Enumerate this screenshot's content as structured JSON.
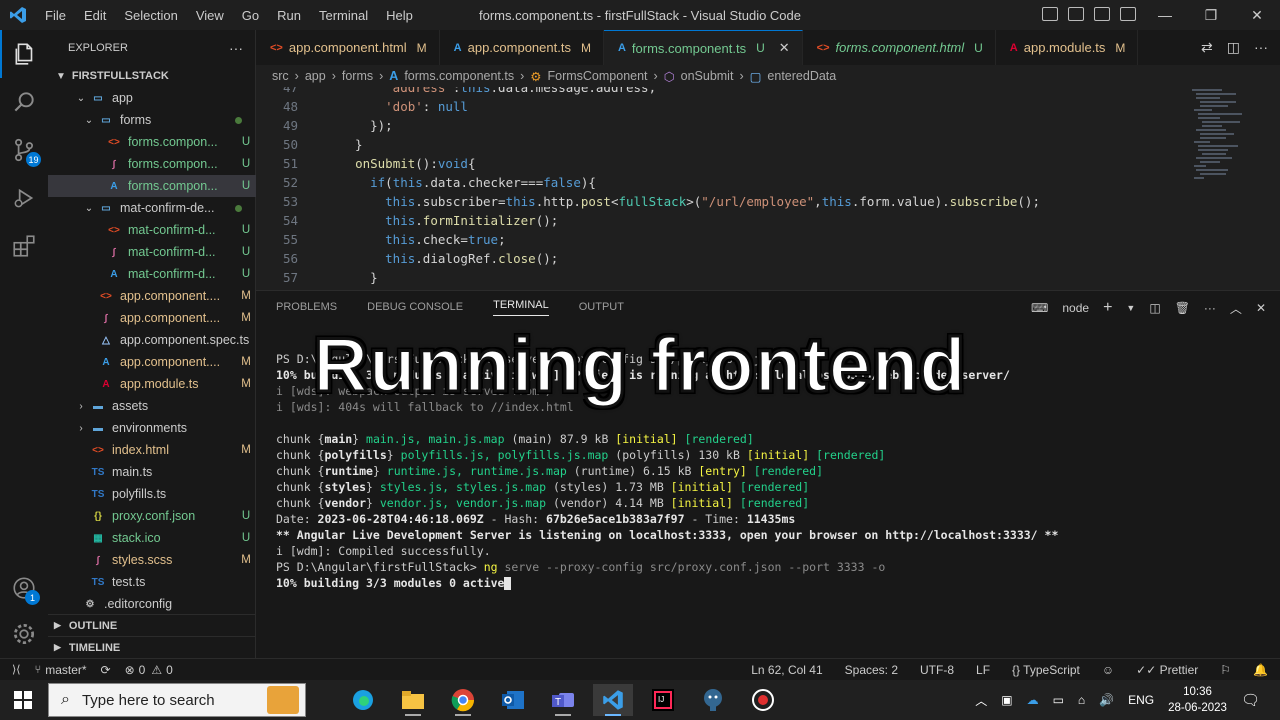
{
  "window": {
    "title": "forms.component.ts - firstFullStack - Visual Studio Code",
    "menu": [
      "File",
      "Edit",
      "Selection",
      "View",
      "Go",
      "Run",
      "Terminal",
      "Help"
    ]
  },
  "activity": {
    "scm_badge": "19",
    "account_badge": "1"
  },
  "explorer": {
    "header": "EXPLORER",
    "project": "FIRSTFULLSTACK",
    "items": [
      {
        "name": "app",
        "status": "",
        "type": "folder-open",
        "depth": 1
      },
      {
        "name": "forms",
        "status": "",
        "type": "folder-open",
        "depth": 2
      },
      {
        "name": "forms.compon...",
        "status": "U",
        "type": "html",
        "depth": 3
      },
      {
        "name": "forms.compon...",
        "status": "U",
        "type": "scss",
        "depth": 3
      },
      {
        "name": "forms.compon...",
        "status": "U",
        "type": "ts",
        "depth": 3,
        "selected": true
      },
      {
        "name": "mat-confirm-de...",
        "status": "",
        "type": "folder-open",
        "depth": 2
      },
      {
        "name": "mat-confirm-d...",
        "status": "U",
        "type": "html",
        "depth": 3
      },
      {
        "name": "mat-confirm-d...",
        "status": "U",
        "type": "scss",
        "depth": 3
      },
      {
        "name": "mat-confirm-d...",
        "status": "U",
        "type": "ts",
        "depth": 3
      },
      {
        "name": "app.component....",
        "status": "M",
        "type": "html",
        "depth": 2
      },
      {
        "name": "app.component....",
        "status": "M",
        "type": "scss",
        "depth": 2
      },
      {
        "name": "app.component.spec.ts",
        "status": "",
        "type": "spec",
        "depth": 2
      },
      {
        "name": "app.component....",
        "status": "M",
        "type": "ts",
        "depth": 2
      },
      {
        "name": "app.module.ts",
        "status": "M",
        "type": "module",
        "depth": 2
      },
      {
        "name": "assets",
        "status": "",
        "type": "folder",
        "depth": 1
      },
      {
        "name": "environments",
        "status": "",
        "type": "folder",
        "depth": 1
      },
      {
        "name": "index.html",
        "status": "M",
        "type": "html",
        "depth": 1
      },
      {
        "name": "main.ts",
        "status": "",
        "type": "tsfile",
        "depth": 1
      },
      {
        "name": "polyfills.ts",
        "status": "",
        "type": "tsfile",
        "depth": 1
      },
      {
        "name": "proxy.conf.json",
        "status": "U",
        "type": "json",
        "depth": 1
      },
      {
        "name": "stack.ico",
        "status": "U",
        "type": "ico",
        "depth": 1
      },
      {
        "name": "styles.scss",
        "status": "M",
        "type": "scss",
        "depth": 1
      },
      {
        "name": "test.ts",
        "status": "",
        "type": "tsfile",
        "depth": 1
      },
      {
        "name": ".editorconfig",
        "status": "",
        "type": "config",
        "depth": 0
      }
    ],
    "outline": "OUTLINE",
    "timeline": "TIMELINE"
  },
  "tabs": [
    {
      "label": "app.component.html",
      "mod": "M",
      "type": "html"
    },
    {
      "label": "app.component.ts",
      "mod": "M",
      "type": "ts"
    },
    {
      "label": "forms.component.ts",
      "mod": "U",
      "type": "ts",
      "active": true
    },
    {
      "label": "forms.component.html",
      "mod": "U",
      "type": "html",
      "italic": true
    },
    {
      "label": "app.module.ts",
      "mod": "M",
      "type": "module"
    }
  ],
  "breadcrumb": [
    "src",
    "app",
    "forms",
    "forms.component.ts",
    "FormsComponent",
    "onSubmit",
    "enteredData"
  ],
  "editor": {
    "lines": [
      {
        "n": "47",
        "code": "      'address':this.data.message.address,"
      },
      {
        "n": "48",
        "code": "      'dob': null"
      },
      {
        "n": "49",
        "code": "    });"
      },
      {
        "n": "50",
        "code": "  }"
      },
      {
        "n": "51",
        "code": "  onSubmit():void{"
      },
      {
        "n": "52",
        "code": "    if(this.data.checker===false){"
      },
      {
        "n": "53",
        "code": "      this.subscriber=this.http.post<fullStack>(\"/url/employee\",this.form.value).subscribe();"
      },
      {
        "n": "54",
        "code": "      this.formInitializer();"
      },
      {
        "n": "55",
        "code": "      this.check=true;"
      },
      {
        "n": "56",
        "code": "      this.dialogRef.close();"
      },
      {
        "n": "57",
        "code": "    }"
      }
    ]
  },
  "panel": {
    "tabs": [
      "PROBLEMS",
      "DEBUG CONSOLE",
      "TERMINAL",
      "OUTPUT"
    ],
    "active_tab": "TERMINAL",
    "shell": "node"
  },
  "terminal": {
    "l1": "PS D:\\Angular\\firstFullStack> ng serve --proxy-config src/proxy.conf.json",
    "l2": "10% building 3/3 modules 0 active i [wds]: Project is running at http://localhost:3333/webpack-dev-server/",
    "l3": "i [wds]: webpack output is served from /",
    "l4": "i [wds]: 404s will fallback to //index.html",
    "chunks": [
      {
        "pre": "chunk {",
        "name": "main",
        "post": "} ",
        "files": "main.js, main.js.map",
        "rest": " (main) 87.9 kB ",
        "flag1": "[initial]",
        "flag2": "[rendered]"
      },
      {
        "pre": "chunk {",
        "name": "polyfills",
        "post": "} ",
        "files": "polyfills.js, polyfills.js.map",
        "rest": " (polyfills) 130 kB ",
        "flag1": "[initial]",
        "flag2": "[rendered]"
      },
      {
        "pre": "chunk {",
        "name": "runtime",
        "post": "} ",
        "files": "runtime.js, runtime.js.map",
        "rest": " (runtime) 6.15 kB ",
        "flag1": "[entry]",
        "flag2": "[rendered]"
      },
      {
        "pre": "chunk {",
        "name": "styles",
        "post": "} ",
        "files": "styles.js, styles.js.map",
        "rest": " (styles) 1.73 MB ",
        "flag1": "[initial]",
        "flag2": "[rendered]"
      },
      {
        "pre": "chunk {",
        "name": "vendor",
        "post": "} ",
        "files": "vendor.js, vendor.js.map",
        "rest": " (vendor) 4.14 MB ",
        "flag1": "[initial]",
        "flag2": "[rendered]"
      }
    ],
    "date_label": "Date: ",
    "date": "2023-06-28T04:46:18.069Z",
    "hash_label": " - Hash: ",
    "hash": "67b26e5ace1b383a7f97",
    "time_label": " - Time: ",
    "time": "11435ms",
    "live": "** Angular Live Development Server is listening on localhost:3333, open your browser on http://localhost:3333/ **",
    "compiled": "i [wdm]: Compiled successfully.",
    "prompt": "PS D:\\Angular\\firstFullStack> ",
    "cmd_ng": "ng",
    "cmd_rest": " serve --proxy-config src/proxy.conf.json --port 3333 -o",
    "last": "10% building 3/3 modules 0 active"
  },
  "overlay_text": "Running frontend",
  "statusbar": {
    "branch": "master*",
    "errors": "0",
    "warnings": "0",
    "position": "Ln 62, Col 41",
    "spaces": "Spaces: 2",
    "encoding": "UTF-8",
    "eol": "LF",
    "language": "TypeScript",
    "prettier": "Prettier"
  },
  "taskbar": {
    "search_placeholder": "Type here to search",
    "lang": "ENG",
    "time": "10:36",
    "date": "28-06-2023"
  }
}
